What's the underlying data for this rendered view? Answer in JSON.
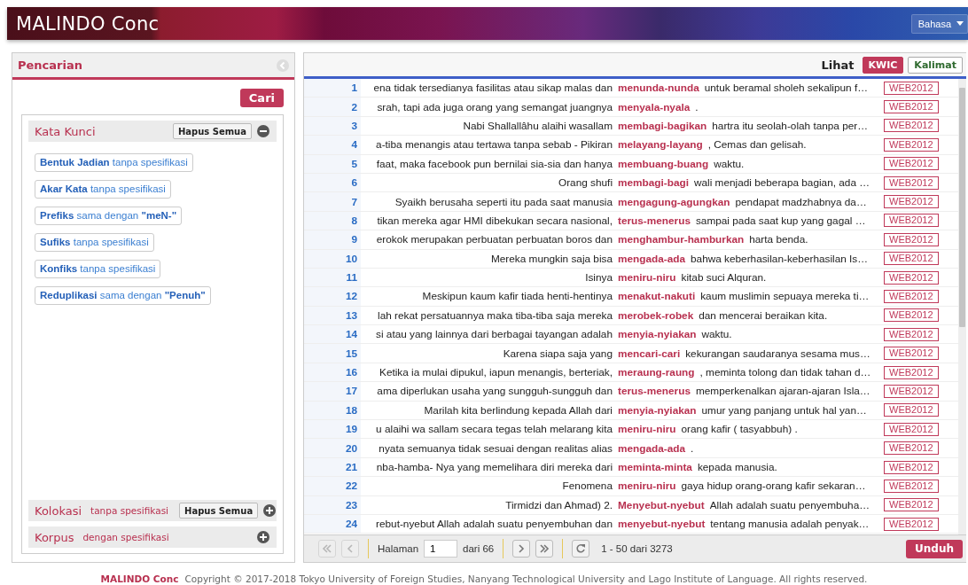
{
  "header": {
    "title": "MALINDO Conc",
    "language_button": "Bahasa"
  },
  "search_panel": {
    "title": "Pencarian",
    "search_button": "Cari",
    "sections": [
      {
        "title": "Kata Kunci",
        "clear_button": "Hapus Semua",
        "expanded": true,
        "chips": [
          "**Bentuk Jadian** tanpa spesifikasi",
          "**Akar Kata** tanpa spesifikasi",
          "**Prefiks** sama dengan **\"meN-\"**",
          "**Sufiks** tanpa spesifikasi",
          "**Konfiks** tanpa spesifikasi",
          "**Reduplikasi** sama dengan **\"Penuh\"**"
        ]
      },
      {
        "title": "Kolokasi",
        "note": "tanpa spesifikasi",
        "clear_button": "Hapus Semua",
        "expanded": false
      },
      {
        "title": "Korpus",
        "note": "dengan spesifikasi",
        "expanded": false
      }
    ]
  },
  "results": {
    "view_label": "Lihat",
    "views": [
      {
        "label": "KWIC",
        "selected": true
      },
      {
        "label": "Kalimat",
        "selected": false
      }
    ],
    "rows": [
      {
        "n": "1",
        "left": "ena tidak tersedianya fasilitas atau sikap malas dan",
        "keyword": "menunda-nunda",
        "right": "untuk beramal sholeh sekalipun f…",
        "source": "WEB2012"
      },
      {
        "n": "2",
        "left": "srah, tapi ada juga orang yang semangat juangnya",
        "keyword": "menyala-nyala",
        "right": ".",
        "source": "WEB2012"
      },
      {
        "n": "3",
        "left": "Nabi Shallallâhu alaihi wasallam",
        "keyword": "membagi-bagikan",
        "right": "hartra itu seolah-olah tanpa per…",
        "source": "WEB2012"
      },
      {
        "n": "4",
        "left": "a-tiba menangis atau tertawa tanpa sebab - Pikiran",
        "keyword": "melayang-layang",
        "right": ", Cemas dan gelisah.",
        "source": "WEB2012"
      },
      {
        "n": "5",
        "left": "faat, maka facebook pun bernilai sia-sia dan hanya",
        "keyword": "membuang-buang",
        "right": "waktu.",
        "source": "WEB2012"
      },
      {
        "n": "6",
        "left": "Orang shufi",
        "keyword": "membagi-bagi",
        "right": "wali menjadi beberapa bagian, ada …",
        "source": "WEB2012"
      },
      {
        "n": "7",
        "left": "Syaikh berusaha seperti itu pada saat manusia",
        "keyword": "mengagung-agungkan",
        "right": "pendapat madzhabnya da…",
        "source": "WEB2012"
      },
      {
        "n": "8",
        "left": "tikan mereka agar HMI dibekukan secara nasional,",
        "keyword": "terus-menerus",
        "right": "sampai pada saat kup yang gagal …",
        "source": "WEB2012"
      },
      {
        "n": "9",
        "left": "erokok merupakan perbuatan perbuatan boros dan",
        "keyword": "menghambur-hamburkan",
        "right": "harta benda.",
        "source": "WEB2012"
      },
      {
        "n": "10",
        "left": "Mereka mungkin saja bisa",
        "keyword": "mengada-ada",
        "right": "bahwa keberhasilan-keberhasilan Is…",
        "source": "WEB2012"
      },
      {
        "n": "11",
        "left": "Isinya",
        "keyword": "meniru-niru",
        "right": "kitab suci Alquran.",
        "source": "WEB2012"
      },
      {
        "n": "12",
        "left": "Meskipun kaum kafir tiada henti-hentinya",
        "keyword": "menakut-nakuti",
        "right": "kaum muslimin sepuaya mereka ti…",
        "source": "WEB2012"
      },
      {
        "n": "13",
        "left": "lah rekat persatuannya maka tiba-tiba saja mereka",
        "keyword": "merobek-robek",
        "right": "dan mencerai beraikan kita.",
        "source": "WEB2012"
      },
      {
        "n": "14",
        "left": "si atau yang lainnya dari berbagai tayangan adalah",
        "keyword": "menyia-nyiakan",
        "right": "waktu.",
        "source": "WEB2012"
      },
      {
        "n": "15",
        "left": "Karena siapa saja yang",
        "keyword": "mencari-cari",
        "right": "kekurangan saudaranya sesama mus…",
        "source": "WEB2012"
      },
      {
        "n": "16",
        "left": "Ketika ia mulai dipukul, iapun menangis, berteriak,",
        "keyword": "meraung-raung",
        "right": ", meminta tolong dan tidak tahan d…",
        "source": "WEB2012"
      },
      {
        "n": "17",
        "left": "ama diperlukan usaha yang sungguh-sungguh dan",
        "keyword": "terus-menerus",
        "right": "memperkenalkan ajaran-ajaran Isla…",
        "source": "WEB2012"
      },
      {
        "n": "18",
        "left": "Marilah kita berlindung kepada Allah dari",
        "keyword": "menyia-nyiakan",
        "right": "umur yang panjang untuk hal yan…",
        "source": "WEB2012"
      },
      {
        "n": "19",
        "left": "u alaihi wa sallam secara tegas telah melarang kita",
        "keyword": "meniru-niru",
        "right": "orang kafir ( tasyabbuh) .",
        "source": "WEB2012"
      },
      {
        "n": "20",
        "left": "nyata semuanya tidak sesuai dengan realitas alias",
        "keyword": "mengada-ada",
        "right": ".",
        "source": "WEB2012"
      },
      {
        "n": "21",
        "left": "nba-hamba- Nya yang memelihara diri mereka dari",
        "keyword": "meminta-minta",
        "right": "kepada manusia.",
        "source": "WEB2012"
      },
      {
        "n": "22",
        "left": "Fenomena",
        "keyword": "meniru-niru",
        "right": "gaya hidup orang-orang kafir sekaran…",
        "source": "WEB2012"
      },
      {
        "n": "23",
        "left": "Tirmidzi dan Ahmad) 2.",
        "keyword": "Menyebut-nyebut",
        "right": "Allah adalah suatu penyembuha…",
        "source": "WEB2012"
      },
      {
        "n": "24",
        "left": "rebut-nyebut Allah adalah suatu penyembuhan dan",
        "keyword": "menyebut-nyebut",
        "right": "tentang manusia adalah penyak…",
        "source": "WEB2012"
      }
    ],
    "pager": {
      "page_label": "Halaman",
      "page": "1",
      "page_total": "dari 66",
      "range": "1 - 50 dari 3273",
      "download_button": "Unduh"
    }
  },
  "footer": {
    "brand": "MALINDO Conc",
    "copyright": "Copyright © 2017-2018 Tokyo University of Foreign Studies, Nanyang Technological University and Lago Institute of Language. All rights reserved."
  }
}
